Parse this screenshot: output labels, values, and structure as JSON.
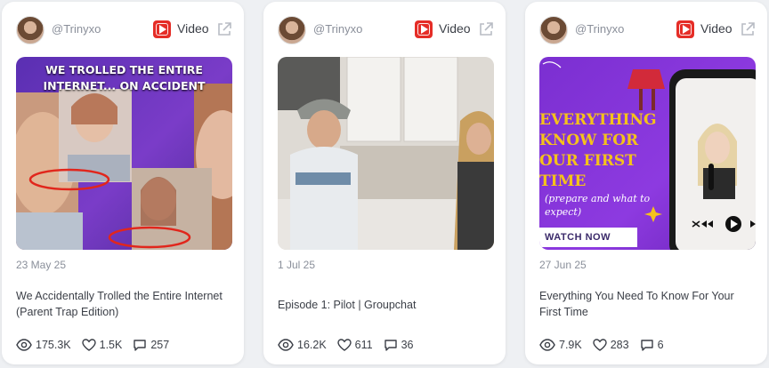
{
  "cards": [
    {
      "username": "@Trinyxo",
      "type_label": "Video",
      "thumbnail_text": "WE TROLLED THE ENTIRE INTERNET... ON ACCIDENT",
      "date": "23 May 25",
      "title": "We Accidentally Trolled the Entire Internet (Parent Trap Edition)",
      "views": "175.3K",
      "likes": "1.5K",
      "comments": "257"
    },
    {
      "username": "@Trinyxo",
      "type_label": "Video",
      "thumbnail_text": "",
      "date": "1 Jul 25",
      "title": "Episode 1: Pilot | Groupchat",
      "views": "16.2K",
      "likes": "611",
      "comments": "36"
    },
    {
      "username": "@Trinyxo",
      "type_label": "Video",
      "thumbnail_text_main": "EVERYTHING KNOW FOR OUR FIRST TIME",
      "thumbnail_text_sub": "(prepare and what to expect)",
      "thumbnail_button": "WATCH NOW",
      "date": "27 Jun 25",
      "title": "Everything You Need To Know For Your First Time",
      "views": "7.9K",
      "likes": "283",
      "comments": "6"
    }
  ],
  "colors": {
    "youtube_red": "#e52d27",
    "text_primary": "#3b3f47",
    "text_muted": "#8a8f9a",
    "card_bg": "#ffffff",
    "page_bg": "#eef0f3"
  },
  "icons": {
    "platform": "youtube-icon",
    "external": "external-link-icon",
    "views": "eye-icon",
    "likes": "heart-icon",
    "comments": "comment-icon"
  }
}
